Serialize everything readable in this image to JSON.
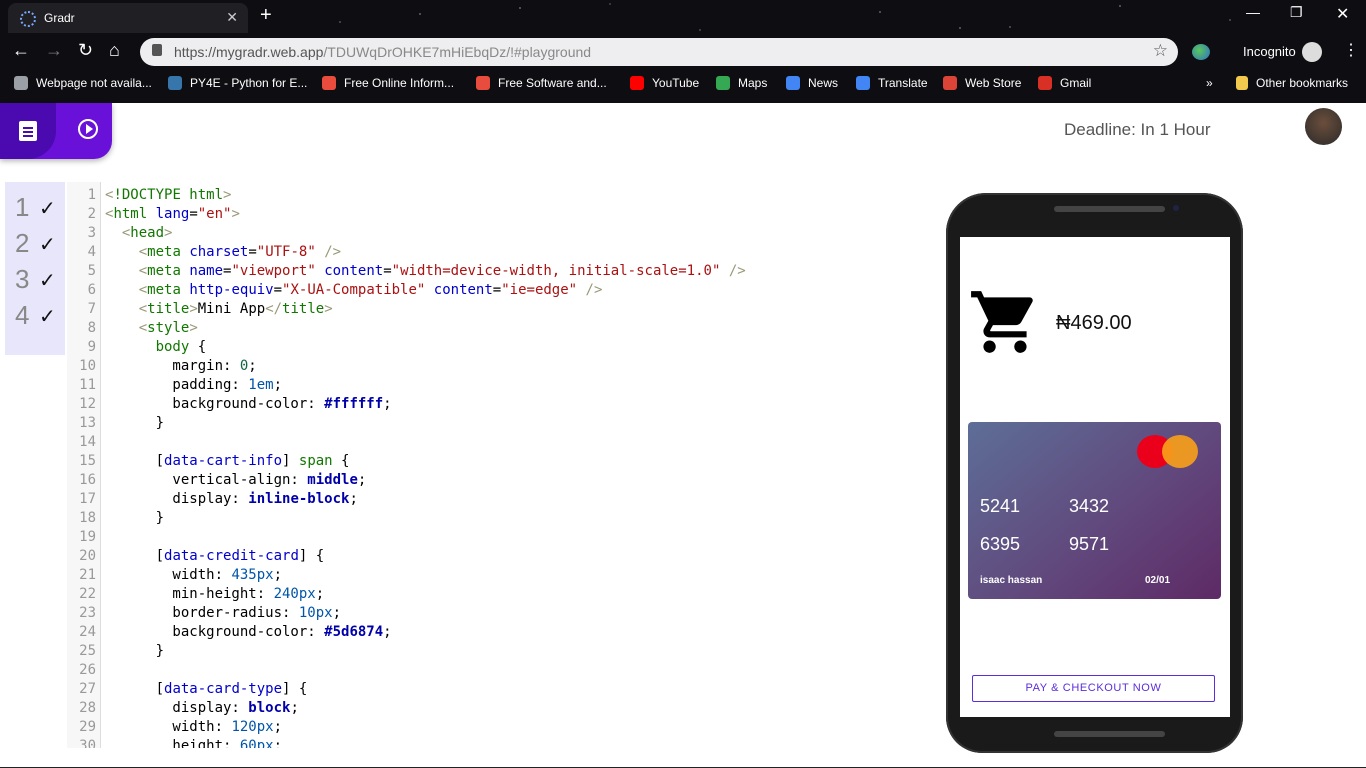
{
  "browser": {
    "tab_title": "Gradr",
    "url_domain": "https://mygradr.web.app",
    "url_path": "/TDUWqDrOHKE7mHiEbqDz/!#playground",
    "incognito_label": "Incognito",
    "bookmarks": [
      {
        "label": "Webpage not availa...",
        "icon": "globe-icon",
        "color": "#9aa0a6"
      },
      {
        "label": "PY4E - Python for E...",
        "icon": "python-icon",
        "color": "#3776ab"
      },
      {
        "label": "Free Online Inform...",
        "icon": "alison-icon",
        "color": "#e74c3c"
      },
      {
        "label": "Free Software and...",
        "icon": "alison-icon",
        "color": "#e74c3c"
      },
      {
        "label": "YouTube",
        "icon": "youtube-icon",
        "color": "#ff0000"
      },
      {
        "label": "Maps",
        "icon": "maps-icon",
        "color": "#34a853"
      },
      {
        "label": "News",
        "icon": "news-icon",
        "color": "#4285f4"
      },
      {
        "label": "Translate",
        "icon": "translate-icon",
        "color": "#4285f4"
      },
      {
        "label": "Web Store",
        "icon": "webstore-icon",
        "color": "#db4437"
      },
      {
        "label": "Gmail",
        "icon": "gmail-icon",
        "color": "#d93025"
      }
    ],
    "overflow_label": "»",
    "other_bookmarks": "Other bookmarks"
  },
  "app": {
    "deadline": "Deadline: In 1 Hour",
    "checklist": [
      "1",
      "2",
      "3",
      "4"
    ],
    "accent_color": "#6a11d9"
  },
  "editor": {
    "line_numbers": [
      "1",
      "2",
      "3",
      "4",
      "5",
      "6",
      "7",
      "8",
      "9",
      "10",
      "11",
      "12",
      "13",
      "14",
      "15",
      "16",
      "17",
      "18",
      "19",
      "20",
      "21",
      "22",
      "23",
      "24",
      "25",
      "26",
      "27",
      "28",
      "29",
      "30"
    ]
  },
  "preview": {
    "price": "₦469.00",
    "card_numbers": [
      "5241",
      "3432",
      "6395",
      "9571"
    ],
    "card_holder": "isaac hassan",
    "card_expiry": "02/01",
    "pay_button": "PAY & CHECKOUT NOW"
  }
}
